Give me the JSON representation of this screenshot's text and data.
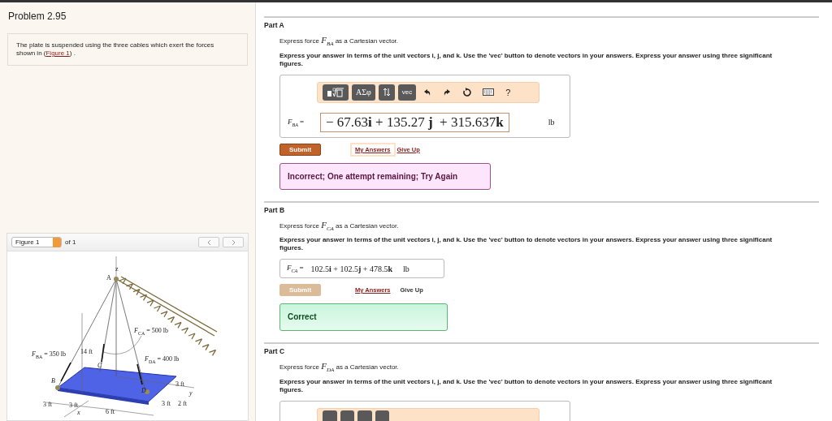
{
  "problem": {
    "title": "Problem 2.95",
    "description": {
      "before": "The plate is suspended using the three cables which exert the forces shown in (",
      "link": "Figure 1",
      "after": ") ."
    }
  },
  "figure_viewer": {
    "select": "Figure 1",
    "count": "of 1",
    "labels": [
      "z",
      "A",
      "*F*$_{CA}$ = 500 lb",
      "*F*$_{BA}$ = 350 lb",
      "14 ft",
      "*C*",
      "*F*$_{DA}$ = 400 lb",
      "*B*",
      "*D*",
      "3 ft",
      "3 ft",
      "*x*",
      "6 ft",
      "*y*",
      "3 ft",
      "3 ft",
      "2 ft"
    ]
  },
  "parts": [
    {
      "title": "Part A",
      "prompt": "Express force *F*$_{BA}$ as a Cartesian vector.",
      "instructions": "Express your answer in terms of the unit vectors i, j, and k. Use the 'vec' button to denote vectors in your answers. Express your answer using three significant figures.",
      "kind": "editor",
      "toolbar": {
        "symbols": "ΑΣφ",
        "vec": "vec",
        "help": "?"
      },
      "answer": {
        "label": "*F*$_{BA}$ =",
        "value": "− 67.63**i** + 135.27 **j**  + 315.637**k**",
        "unit": "lb"
      },
      "submit": {
        "label": "Submit",
        "disabled": false
      },
      "my_answers": {
        "label": "My Answers",
        "focused": true
      },
      "give_up": {
        "label": "Give Up",
        "disabled": false
      },
      "feedback": {
        "kind": "incorrect",
        "text": "Incorrect; One attempt remaining; Try Again"
      }
    },
    {
      "title": "Part B",
      "prompt": "Express force *F*$_{CA}$ as a Cartesian vector.",
      "instructions": "Express your answer in terms of the unit vectors i, j, and k. Use the 'vec' button to denote vectors in your answers. Express your answer using three significant figures.",
      "kind": "plain",
      "answer": {
        "label": "*F*$_{CA}$ =",
        "value": "102.5**i** + 102.5**j** + 478.5**k**",
        "unit": "lb"
      },
      "submit": {
        "label": "Submit",
        "disabled": true
      },
      "my_answers": {
        "label": "My Answers",
        "focused": false
      },
      "give_up": {
        "label": "Give Up",
        "disabled": true
      },
      "feedback": {
        "kind": "correct",
        "text": "Correct"
      }
    },
    {
      "title": "Part C",
      "prompt": "Express force *F*$_{DA}$ as a Cartesian vector.",
      "instructions": "Express your answer in terms of the unit vectors i, j, and k. Use the 'vec' button to denote vectors in your answers. Express your answer using three significant figures.",
      "kind": "editor"
    }
  ]
}
